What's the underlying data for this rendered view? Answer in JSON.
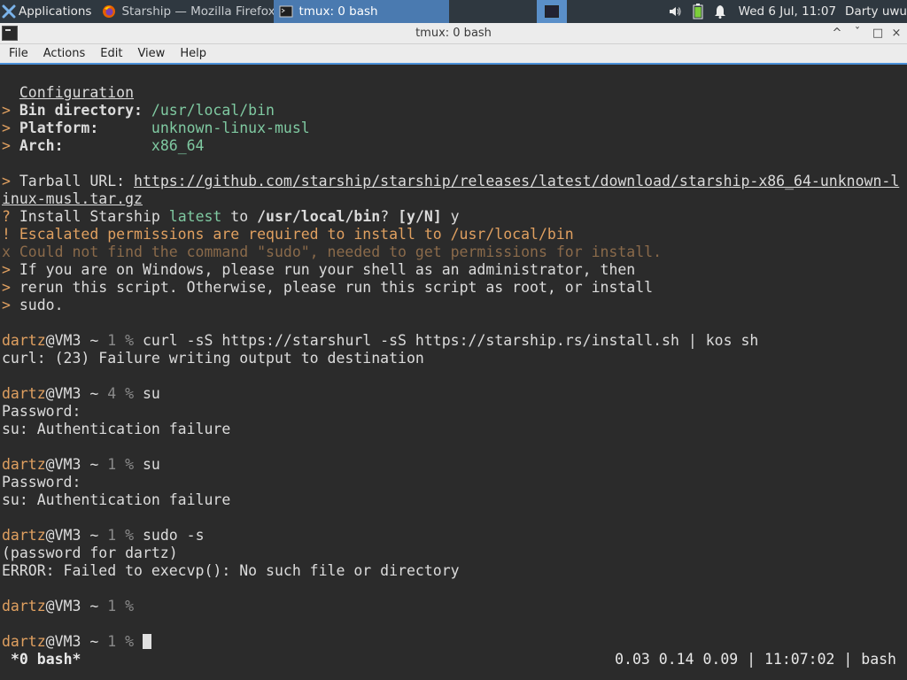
{
  "panel": {
    "applications_label": "Applications",
    "tasks": [
      {
        "label": "Starship — Mozilla Firefox",
        "icon": "firefox-icon"
      },
      {
        "label": "tmux: 0 bash",
        "icon": "terminal-icon"
      }
    ],
    "clock": "Wed  6 Jul, 11:07",
    "user": "Darty uwu",
    "tray_icons": [
      "volume-icon",
      "battery-icon",
      "notification-bell-icon"
    ],
    "colors": {
      "panel_bg": "#2f3840",
      "active_task_bg": "#4a7ab0",
      "launcher_bg": "#5a8fc9"
    }
  },
  "window": {
    "title": "tmux: 0 bash",
    "controls": {
      "minimize": "^",
      "maximize": "ˇ",
      "restore": "□",
      "close": "×"
    }
  },
  "menubar": [
    "File",
    "Actions",
    "Edit",
    "View",
    "Help"
  ],
  "terminal": {
    "lines": [
      {
        "segs": [
          {
            "t": "  "
          },
          {
            "t": "Configuration",
            "c": "u"
          }
        ]
      },
      {
        "segs": [
          {
            "t": "> ",
            "c": "orange"
          },
          {
            "t": "Bin directory:",
            "c": "b"
          },
          {
            "t": " "
          },
          {
            "t": "/usr/local/bin",
            "c": "green"
          }
        ]
      },
      {
        "segs": [
          {
            "t": "> ",
            "c": "orange"
          },
          {
            "t": "Platform:",
            "c": "b"
          },
          {
            "t": "      "
          },
          {
            "t": "unknown-linux-musl",
            "c": "green"
          }
        ]
      },
      {
        "segs": [
          {
            "t": "> ",
            "c": "orange"
          },
          {
            "t": "Arch:",
            "c": "b"
          },
          {
            "t": "          "
          },
          {
            "t": "x86_64",
            "c": "green"
          }
        ]
      },
      {
        "segs": [
          {
            "t": ""
          }
        ]
      },
      {
        "segs": [
          {
            "t": "> ",
            "c": "orange"
          },
          {
            "t": "Tarball URL: "
          },
          {
            "t": "https://github.com/starship/starship/releases/latest/download/starship-x86_64-unknown-l",
            "c": "u"
          }
        ]
      },
      {
        "segs": [
          {
            "t": "inux-musl.tar.gz",
            "c": "u"
          }
        ]
      },
      {
        "segs": [
          {
            "t": "? ",
            "c": "orange"
          },
          {
            "t": "Install Starship "
          },
          {
            "t": "latest",
            "c": "green"
          },
          {
            "t": " to "
          },
          {
            "t": "/usr/local/bin",
            "c": "b"
          },
          {
            "t": "? "
          },
          {
            "t": "[y/N]",
            "c": "b"
          },
          {
            "t": " y"
          }
        ]
      },
      {
        "segs": [
          {
            "t": "! Escalated permissions are required to install to /usr/local/bin",
            "c": "orange"
          }
        ]
      },
      {
        "segs": [
          {
            "t": "x Could not find the command \"sudo\", needed to get permissions for install.",
            "c": "dim"
          }
        ]
      },
      {
        "segs": [
          {
            "t": "> ",
            "c": "orange"
          },
          {
            "t": "If you are on Windows, please run your shell as an administrator, then"
          }
        ]
      },
      {
        "segs": [
          {
            "t": "> ",
            "c": "orange"
          },
          {
            "t": "rerun this script. Otherwise, please run this script as root, or install"
          }
        ]
      },
      {
        "segs": [
          {
            "t": "> ",
            "c": "orange"
          },
          {
            "t": "sudo."
          }
        ]
      },
      {
        "segs": [
          {
            "t": ""
          }
        ]
      },
      {
        "segs": [
          {
            "t": "dartz",
            "c": "orange"
          },
          {
            "t": "@VM3 ~ "
          },
          {
            "t": "1 %",
            "c": "gray"
          },
          {
            "t": " curl -sS https://starshurl -sS https://starship.rs/install.sh | kos sh"
          }
        ]
      },
      {
        "segs": [
          {
            "t": "curl: (23) Failure writing output to destination"
          }
        ]
      },
      {
        "segs": [
          {
            "t": ""
          }
        ]
      },
      {
        "segs": [
          {
            "t": "dartz",
            "c": "orange"
          },
          {
            "t": "@VM3 ~ "
          },
          {
            "t": "4 %",
            "c": "gray"
          },
          {
            "t": " su"
          }
        ]
      },
      {
        "segs": [
          {
            "t": "Password:"
          }
        ]
      },
      {
        "segs": [
          {
            "t": "su: Authentication failure"
          }
        ]
      },
      {
        "segs": [
          {
            "t": ""
          }
        ]
      },
      {
        "segs": [
          {
            "t": "dartz",
            "c": "orange"
          },
          {
            "t": "@VM3 ~ "
          },
          {
            "t": "1 %",
            "c": "gray"
          },
          {
            "t": " su"
          }
        ]
      },
      {
        "segs": [
          {
            "t": "Password:"
          }
        ]
      },
      {
        "segs": [
          {
            "t": "su: Authentication failure"
          }
        ]
      },
      {
        "segs": [
          {
            "t": ""
          }
        ]
      },
      {
        "segs": [
          {
            "t": "dartz",
            "c": "orange"
          },
          {
            "t": "@VM3 ~ "
          },
          {
            "t": "1 %",
            "c": "gray"
          },
          {
            "t": " sudo -s"
          }
        ]
      },
      {
        "segs": [
          {
            "t": "(password for dartz)"
          }
        ]
      },
      {
        "segs": [
          {
            "t": "ERROR: Failed to execvp(): No such file or directory"
          }
        ]
      },
      {
        "segs": [
          {
            "t": ""
          }
        ]
      },
      {
        "segs": [
          {
            "t": "dartz",
            "c": "orange"
          },
          {
            "t": "@VM3 ~ "
          },
          {
            "t": "1 %",
            "c": "gray"
          }
        ]
      },
      {
        "segs": [
          {
            "t": ""
          }
        ]
      },
      {
        "segs": [
          {
            "t": "dartz",
            "c": "orange"
          },
          {
            "t": "@VM3 ~ "
          },
          {
            "t": "1 %",
            "c": "gray"
          },
          {
            "t": " "
          }
        ],
        "cursor": true
      }
    ]
  },
  "tmux_status": {
    "window": "*0 bash*",
    "right": "0.03 0.14 0.09 | 11:07:02 | bash"
  }
}
